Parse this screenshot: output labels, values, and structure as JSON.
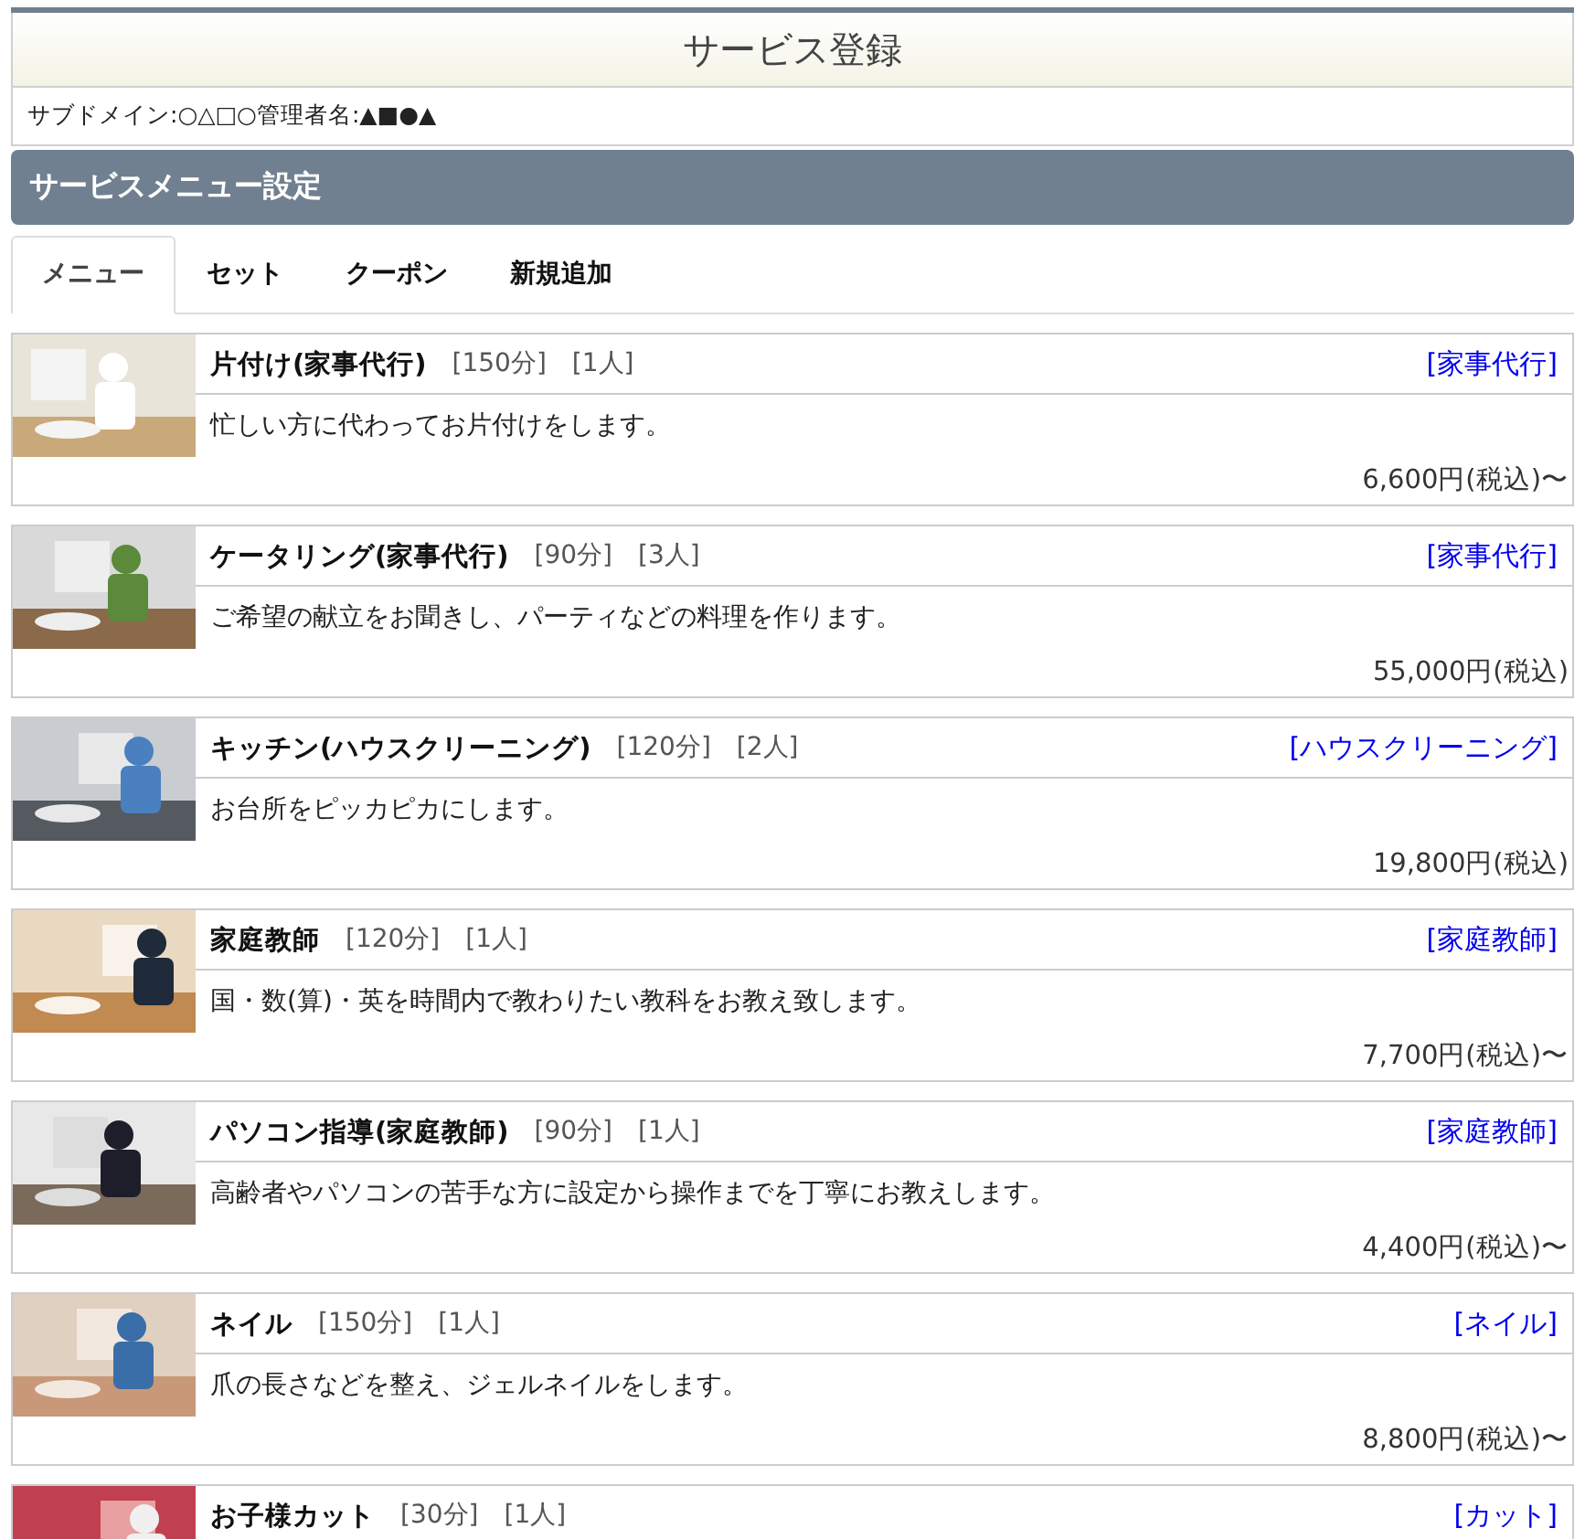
{
  "header": {
    "title": "サービス登録"
  },
  "info": "サブドメイン:○△□○管理者名:▲■●▲",
  "section": {
    "title": "サービスメニュー設定"
  },
  "tabs": [
    {
      "label": "メニュー",
      "selected": true
    },
    {
      "label": "セット",
      "selected": false
    },
    {
      "label": "クーポン",
      "selected": false
    },
    {
      "label": "新規追加",
      "selected": false
    }
  ],
  "services": [
    {
      "name": "片付け(家事代行)",
      "duration": "[150分]",
      "staff": "[1人]",
      "category": "[家事代行]",
      "description": "忙しい方に代わってお片付けをします。",
      "price": "6,600円(税込)〜"
    },
    {
      "name": "ケータリング(家事代行)",
      "duration": "[90分]",
      "staff": "[3人]",
      "category": "[家事代行]",
      "description": "ご希望の献立をお聞きし、パーティなどの料理を作ります。",
      "price": "55,000円(税込)"
    },
    {
      "name": "キッチン(ハウスクリーニング)",
      "duration": "[120分]",
      "staff": "[2人]",
      "category": "[ハウスクリーニング]",
      "description": "お台所をピッカピカにします。",
      "price": "19,800円(税込)"
    },
    {
      "name": "家庭教師",
      "duration": "[120分]",
      "staff": "[1人]",
      "category": "[家庭教師]",
      "description": "国・数(算)・英を時間内で教わりたい教科をお教え致します。",
      "price": "7,700円(税込)〜"
    },
    {
      "name": "パソコン指導(家庭教師)",
      "duration": "[90分]",
      "staff": "[1人]",
      "category": "[家庭教師]",
      "description": "高齢者やパソコンの苦手な方に設定から操作までを丁寧にお教えします。",
      "price": "4,400円(税込)〜"
    },
    {
      "name": "ネイル",
      "duration": "[150分]",
      "staff": "[1人]",
      "category": "[ネイル]",
      "description": "爪の長さなどを整え、ジェルネイルをします。",
      "price": "8,800円(税込)〜"
    },
    {
      "name": "お子様カット",
      "duration": "[30分]",
      "staff": "[1人]",
      "category": "[カット]"
    }
  ]
}
